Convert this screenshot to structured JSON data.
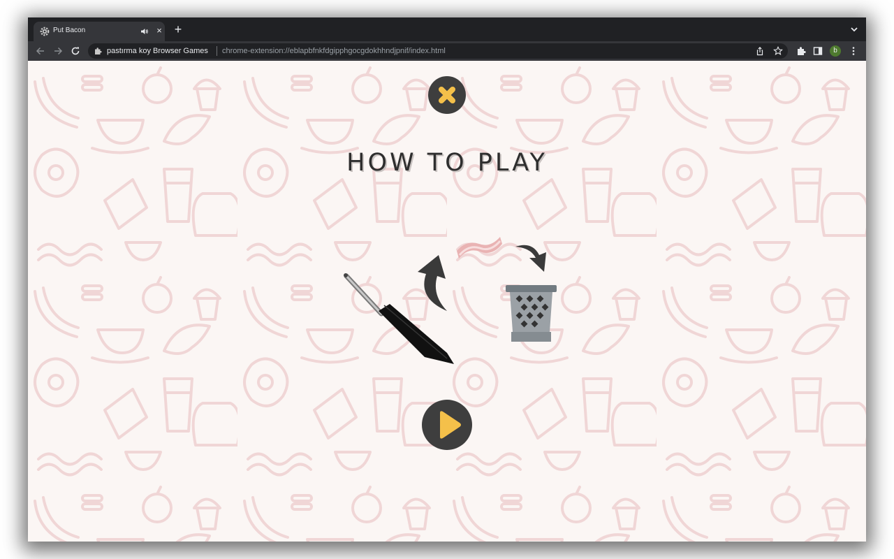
{
  "browser": {
    "tab": {
      "title": "Put Bacon",
      "favicon": "gear-icon",
      "audio_icon": "speaker-icon",
      "close": "×"
    },
    "new_tab": "+",
    "toolbar": {
      "back": "back-arrow-icon",
      "forward": "forward-arrow-icon",
      "reload": "reload-icon"
    },
    "omnibox": {
      "origin": "pastırma koy Browser Games",
      "url": "chrome-extension://eblapbfnkfdgipphgocgdokhhndjpnif/index.html"
    },
    "avatar_letter": "b"
  },
  "game": {
    "title": "HOW TO PLAY",
    "close_icon": "close-x-icon",
    "play_icon": "play-icon",
    "illustration": [
      "frying-pan-icon",
      "curved-arrow-icon",
      "bacon-icon",
      "trash-bin-icon"
    ]
  },
  "colors": {
    "accent": "#f4c04a",
    "button_bg": "#3e3e3e",
    "page_bg": "#fbf6f4",
    "pattern": "#f0d6d6",
    "chrome_dark": "#202124",
    "chrome_mid": "#35363a"
  }
}
